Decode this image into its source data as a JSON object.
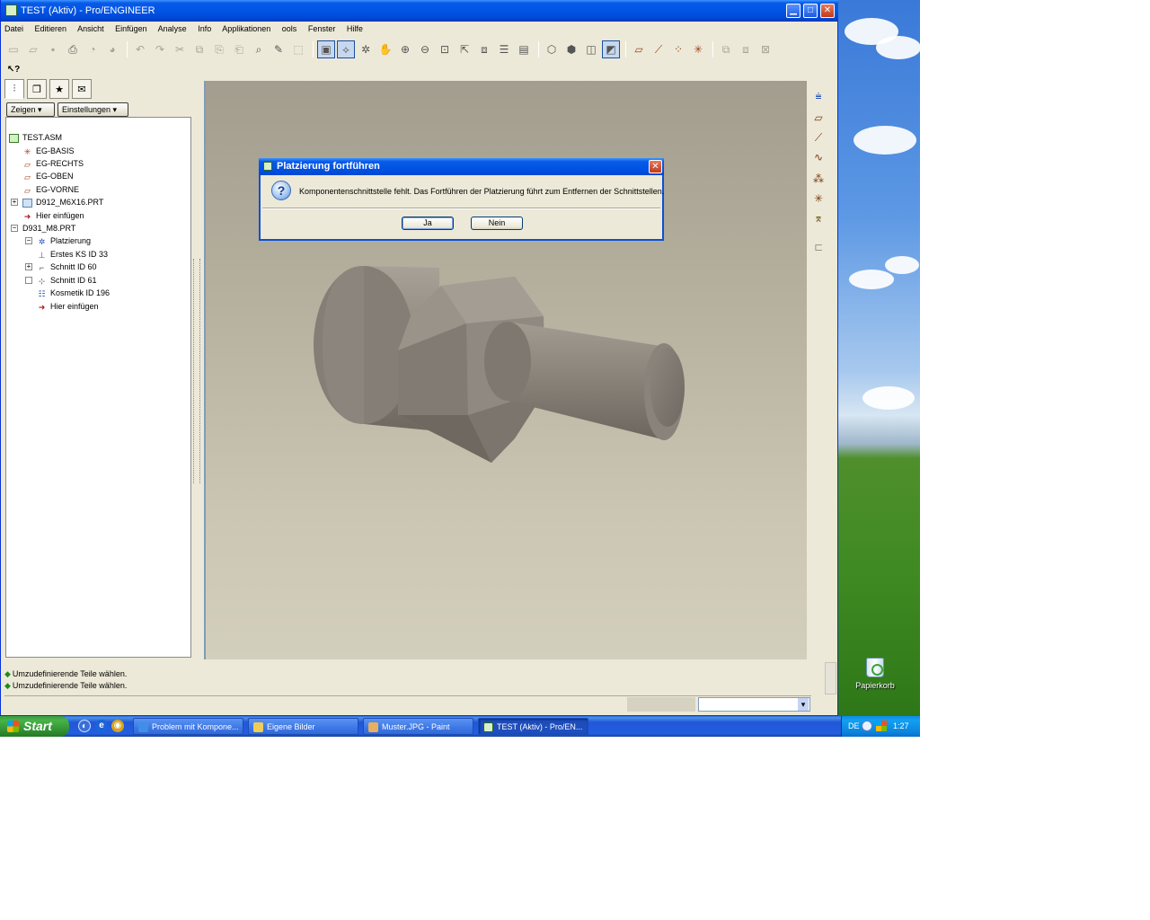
{
  "window": {
    "title": "TEST (Aktiv) - Pro/ENGINEER",
    "minimize_glyph": "▁",
    "maximize_glyph": "□",
    "close_glyph": "✕"
  },
  "menu": [
    "Datei",
    "Editieren",
    "Ansicht",
    "Einfügen",
    "Analyse",
    "Info",
    "Applikationen",
    "ools",
    "Fenster",
    "Hilfe"
  ],
  "panel": {
    "show_button": "Zeigen",
    "settings_button": "Einstellungen"
  },
  "tree": {
    "root": "TEST.ASM",
    "items": [
      "EG-BASIS",
      "EG-RECHTS",
      "EG-OBEN",
      "EG-VORNE",
      "D912_M6X16.PRT",
      "Hier einfügen",
      "D931_M8.PRT",
      "Platzierung",
      "Erstes KS ID 33",
      "Schnitt ID 60",
      "Schnitt ID 61",
      "Kosmetik ID 196",
      "Hier einfügen"
    ]
  },
  "dialog": {
    "title": "Platzierung fortführen",
    "message": "Komponentenschnittstelle fehlt. Das Fortführen der Platzierung führt zum Entfernen der Schnittstellen.",
    "yes": "Ja",
    "no": "Nein"
  },
  "messages": [
    "Umzudefinierende Teile wählen.",
    "Umzudefinierende Teile wählen."
  ],
  "taskbar": {
    "start": "Start",
    "tasks": [
      "Problem mit Kompone...",
      "Eigene Bilder",
      "Muster.JPG - Paint",
      "TEST (Aktiv) - Pro/EN..."
    ],
    "tray_lang": "DE",
    "clock": "1:27"
  },
  "desktop": {
    "recycle_bin": "Papierkorb"
  },
  "colors": {
    "xp_blue": "#0055e5",
    "start_green": "#3c9a3c",
    "viewport_bg": "#b7b19f",
    "model_gray": "#8f877f"
  }
}
